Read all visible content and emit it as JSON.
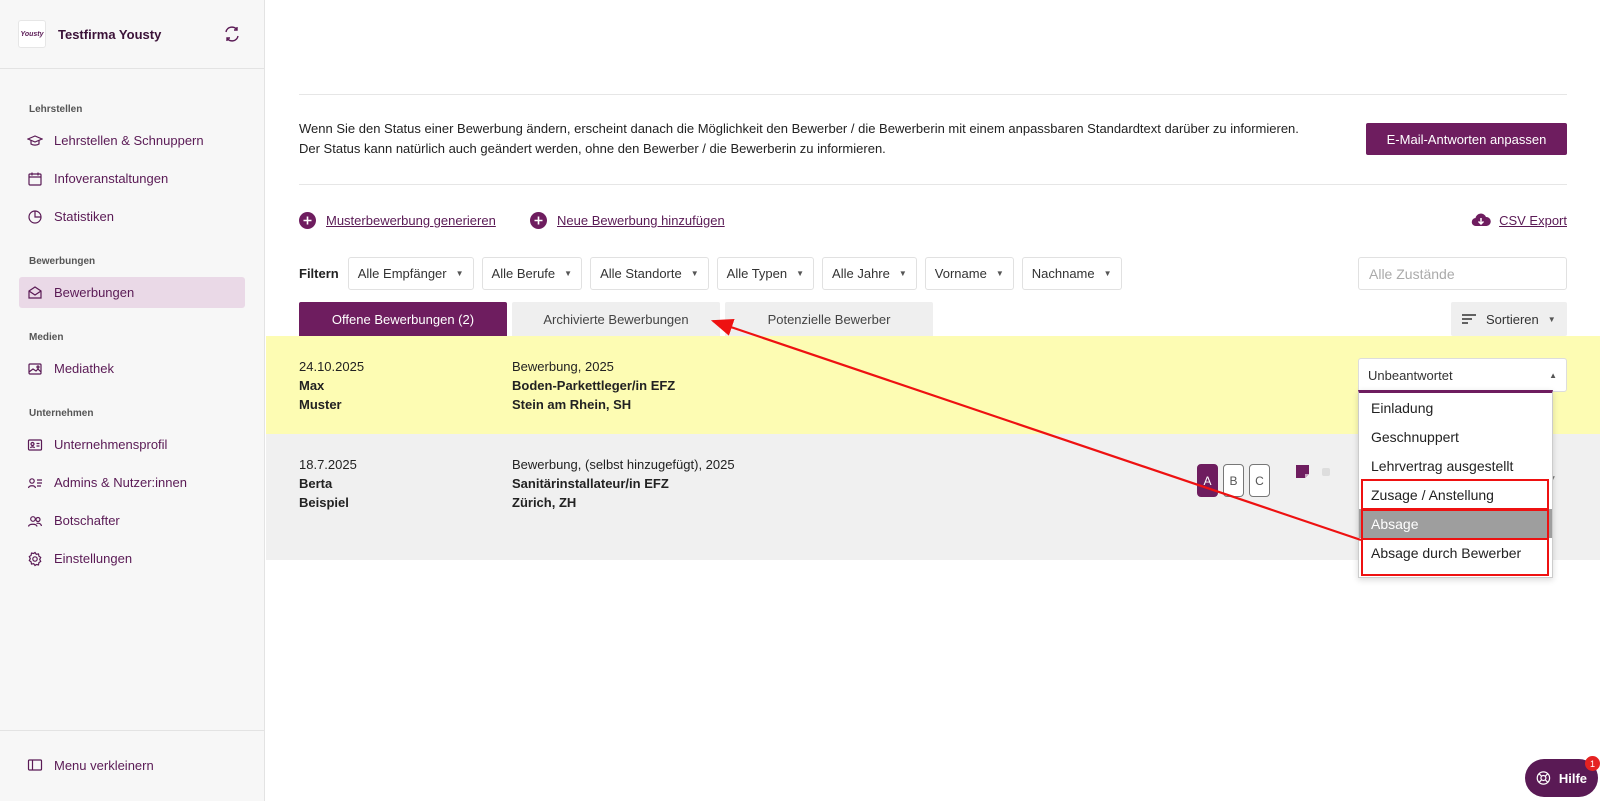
{
  "brand": {
    "logo_text": "Yousty",
    "name": "Testfirma Yousty"
  },
  "sidebar": {
    "sections": [
      {
        "label": "Lehrstellen",
        "items": [
          {
            "label": "Lehrstellen & Schnuppern",
            "icon": "graduation-cap-icon"
          },
          {
            "label": "Infoveranstaltungen",
            "icon": "calendar-icon"
          },
          {
            "label": "Statistiken",
            "icon": "pie-chart-icon"
          }
        ]
      },
      {
        "label": "Bewerbungen",
        "items": [
          {
            "label": "Bewerbungen",
            "icon": "envelope-icon",
            "active": true
          }
        ]
      },
      {
        "label": "Medien",
        "items": [
          {
            "label": "Mediathek",
            "icon": "image-gallery-icon"
          }
        ]
      },
      {
        "label": "Unternehmen",
        "items": [
          {
            "label": "Unternehmensprofil",
            "icon": "id-card-icon"
          },
          {
            "label": "Admins & Nutzer:innen",
            "icon": "user-list-icon"
          },
          {
            "label": "Botschafter",
            "icon": "users-icon"
          },
          {
            "label": "Einstellungen",
            "icon": "gear-icon"
          }
        ]
      }
    ],
    "collapse_label": "Menu verkleinern"
  },
  "main": {
    "info_text": "Wenn Sie den Status einer Bewerbung ändern, erscheint danach die Möglichkeit den Bewerber / die Bewerberin mit einem anpassbaren Standardtext darüber zu informieren. Der Status kann natürlich auch geändert werden, ohne den Bewerber / die Bewerberin zu informieren.",
    "email_button": "E-Mail-Antworten anpassen",
    "actions": {
      "sample": "Musterbewerbung generieren",
      "add": "Neue Bewerbung hinzufügen",
      "csv": "CSV Export"
    },
    "filter": {
      "label": "Filtern",
      "selects": [
        "Alle Empfänger",
        "Alle Berufe",
        "Alle Standorte",
        "Alle Typen",
        "Alle Jahre",
        "Vorname",
        "Nachname"
      ],
      "status_placeholder": "Alle Zustände"
    },
    "tabs": [
      "Offene Bewerbungen (2)",
      "Archivierte Bewerbungen",
      "Potenzielle Bewerber"
    ],
    "sort_label": "Sortieren",
    "applications": [
      {
        "date": "24.10.2025",
        "first": "Max",
        "last": "Muster",
        "type": "Bewerbung, 2025",
        "job": "Boden-Parkettleger/in EFZ",
        "location": "Stein am Rhein, SH",
        "status": "Unbeantwortet"
      },
      {
        "date": "18.7.2025",
        "first": "Berta",
        "last": "Beispiel",
        "type": "Bewerbung, (selbst hinzugefügt), 2025",
        "job": "Sanitärinstallateur/in EFZ",
        "location": "Zürich, ZH",
        "rating": [
          "A",
          "B",
          "C"
        ],
        "rating_selected": "A"
      }
    ],
    "status_options": [
      "Einladung",
      "Geschnuppert",
      "Lehrvertrag ausgestellt",
      "Zusage / Anstellung",
      "Absage",
      "Absage durch Bewerber"
    ],
    "highlighted_option": "Absage"
  },
  "help": {
    "label": "Hilfe",
    "badge": "1"
  },
  "colors": {
    "brand": "#6e1d5f",
    "row_highlight": "#fdfcb3",
    "annotation": "#ee1111"
  }
}
